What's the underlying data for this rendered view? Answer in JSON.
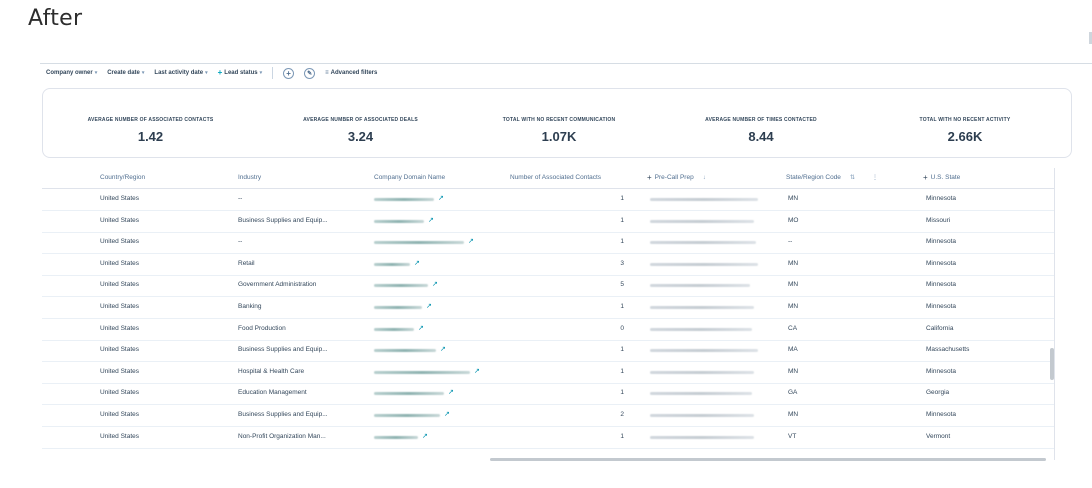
{
  "heading": "After",
  "filters": {
    "company_owner": "Company owner",
    "create_date": "Create date",
    "last_activity_date": "Last activity date",
    "lead_status": "Lead status",
    "advanced_filters": "Advanced filters"
  },
  "metrics": [
    {
      "label": "AVERAGE NUMBER OF ASSOCIATED CONTACTS",
      "value": "1.42"
    },
    {
      "label": "AVERAGE NUMBER OF ASSOCIATED DEALS",
      "value": "3.24"
    },
    {
      "label": "TOTAL WITH NO RECENT COMMUNICATION",
      "value": "1.07K"
    },
    {
      "label": "AVERAGE NUMBER OF TIMES CONTACTED",
      "value": "8.44"
    },
    {
      "label": "TOTAL WITH NO RECENT ACTIVITY",
      "value": "2.66K"
    }
  ],
  "columns": {
    "country": "Country/Region",
    "industry": "Industry",
    "domain": "Company Domain Name",
    "contacts": "Number of Associated Contacts",
    "precall": "Pre-Call Prep",
    "state_code": "State/Region Code",
    "us_state": "U.S. State"
  },
  "rows": [
    {
      "country": "United States",
      "industry": "--",
      "contacts": "1",
      "state_code": "MN",
      "us_state": "Minnesota"
    },
    {
      "country": "United States",
      "industry": "Business Supplies and Equip...",
      "contacts": "1",
      "state_code": "MO",
      "us_state": "Missouri"
    },
    {
      "country": "United States",
      "industry": "--",
      "contacts": "1",
      "state_code": "--",
      "us_state": "Minnesota"
    },
    {
      "country": "United States",
      "industry": "Retail",
      "contacts": "3",
      "state_code": "MN",
      "us_state": "Minnesota"
    },
    {
      "country": "United States",
      "industry": "Government Administration",
      "contacts": "5",
      "state_code": "MN",
      "us_state": "Minnesota"
    },
    {
      "country": "United States",
      "industry": "Banking",
      "contacts": "1",
      "state_code": "MN",
      "us_state": "Minnesota"
    },
    {
      "country": "United States",
      "industry": "Food Production",
      "contacts": "0",
      "state_code": "CA",
      "us_state": "California"
    },
    {
      "country": "United States",
      "industry": "Business Supplies and Equip...",
      "contacts": "1",
      "state_code": "MA",
      "us_state": "Massachusetts"
    },
    {
      "country": "United States",
      "industry": "Hospital & Health Care",
      "contacts": "1",
      "state_code": "MN",
      "us_state": "Minnesota"
    },
    {
      "country": "United States",
      "industry": "Education Management",
      "contacts": "1",
      "state_code": "GA",
      "us_state": "Georgia"
    },
    {
      "country": "United States",
      "industry": "Business Supplies and Equip...",
      "contacts": "2",
      "state_code": "MN",
      "us_state": "Minnesota"
    },
    {
      "country": "United States",
      "industry": "Non-Profit Organization Man...",
      "contacts": "1",
      "state_code": "VT",
      "us_state": "Vermont"
    }
  ]
}
